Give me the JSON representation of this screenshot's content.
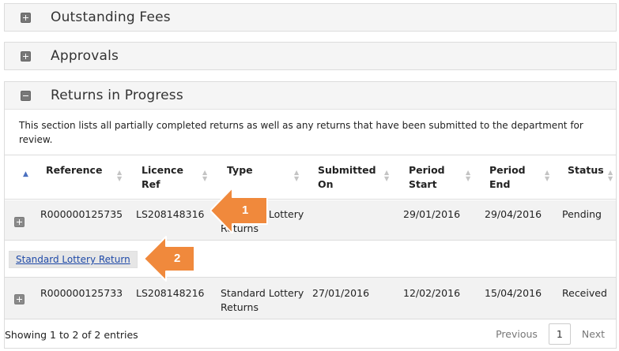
{
  "panels": {
    "outstanding_fees": {
      "label": "Outstanding Fees"
    },
    "approvals": {
      "label": "Approvals"
    },
    "returns_in_progress": {
      "label": "Returns in Progress",
      "description": "This section lists all partially completed returns as well as any returns that have been submitted to the department for review."
    }
  },
  "table": {
    "columns": [
      {
        "label": "Reference"
      },
      {
        "label": "Licence Ref"
      },
      {
        "label": "Type"
      },
      {
        "label": "Submitted On"
      },
      {
        "label": "Period Start"
      },
      {
        "label": "Period End"
      },
      {
        "label": "Status"
      }
    ],
    "rows": [
      {
        "reference": "R000000125735",
        "licence_ref": "LS208148316",
        "type": "Standard Lottery Returns",
        "submitted_on": "",
        "period_start": "29/01/2016",
        "period_end": "29/04/2016",
        "status": "Pending",
        "expanded": true,
        "detail_link": "Standard Lottery Return"
      },
      {
        "reference": "R000000125733",
        "licence_ref": "LS208148216",
        "type": "Standard Lottery Returns",
        "submitted_on": "27/01/2016",
        "period_start": "12/02/2016",
        "period_end": "15/04/2016",
        "status": "Received",
        "expanded": false
      }
    ]
  },
  "footer": {
    "info": "Showing 1 to 2 of 2 entries",
    "previous": "Previous",
    "page": "1",
    "next": "Next"
  },
  "callouts": [
    {
      "number": "1",
      "color": "#f0893c"
    },
    {
      "number": "2",
      "color": "#f0893c"
    }
  ],
  "icons": {
    "collapsed": "plus-square-icon",
    "expanded": "minus-square-icon",
    "sort_active": "sort-asc-icon",
    "sort": "sort-both-icon"
  }
}
